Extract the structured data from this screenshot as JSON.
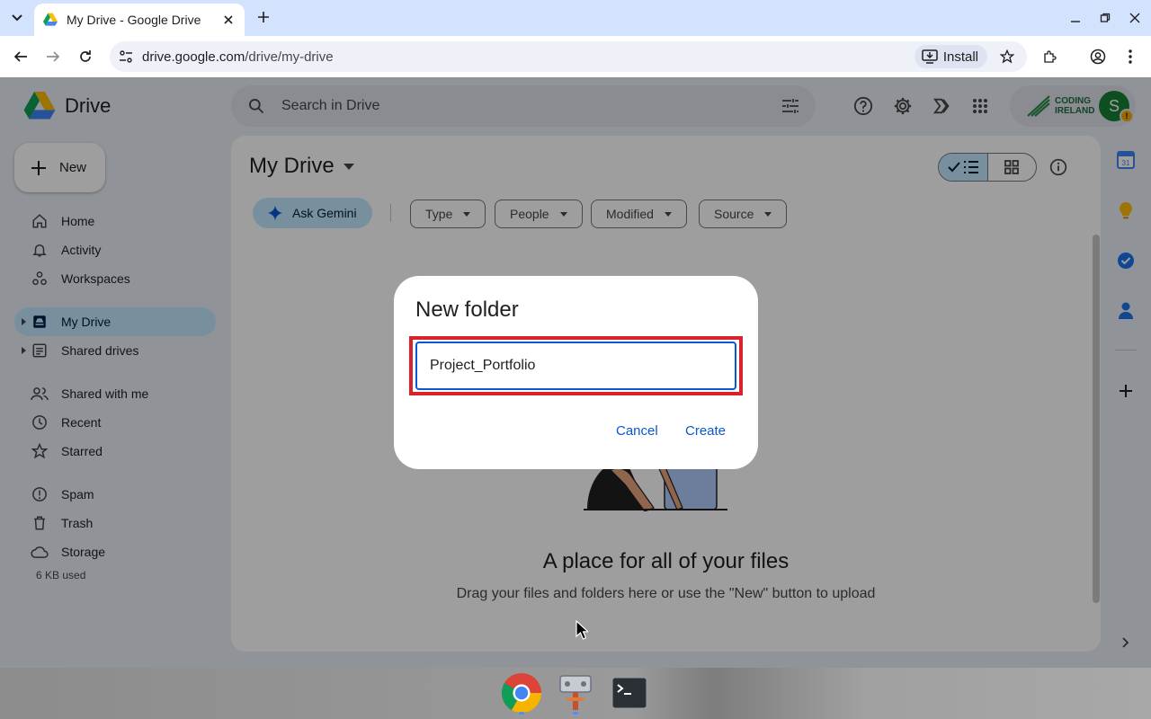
{
  "browser": {
    "tab_title": "My Drive - Google Drive",
    "url_host": "drive.google.com",
    "url_path": "/drive/my-drive",
    "install_label": "Install"
  },
  "header": {
    "app_name": "Drive",
    "search_placeholder": "Search in Drive",
    "org_logo_text_1": "CODING",
    "org_logo_text_2": "IRELAND",
    "avatar_initial": "S",
    "avatar_badge": "!"
  },
  "sidebar": {
    "new_label": "New",
    "items": [
      {
        "label": "Home",
        "icon": "home-icon"
      },
      {
        "label": "Activity",
        "icon": "bell-icon"
      },
      {
        "label": "Workspaces",
        "icon": "workspaces-icon"
      },
      {
        "label": "My Drive",
        "icon": "my-drive-icon",
        "active": true
      },
      {
        "label": "Shared drives",
        "icon": "shared-drives-icon"
      },
      {
        "label": "Shared with me",
        "icon": "people-icon"
      },
      {
        "label": "Recent",
        "icon": "clock-icon"
      },
      {
        "label": "Starred",
        "icon": "star-icon"
      },
      {
        "label": "Spam",
        "icon": "spam-icon"
      },
      {
        "label": "Trash",
        "icon": "trash-icon"
      },
      {
        "label": "Storage",
        "icon": "cloud-icon"
      }
    ],
    "storage_used": "6 KB used"
  },
  "main": {
    "title": "My Drive",
    "gemini_label": "Ask Gemini",
    "filters": [
      "Type",
      "People",
      "Modified",
      "Source"
    ],
    "empty_title": "A place for all of your files",
    "empty_subtitle": "Drag your files and folders here or use the \"New\" button to upload"
  },
  "side_panel": {
    "calendar_day": "31"
  },
  "dialog": {
    "title": "New folder",
    "input_value": "Project_Portfolio",
    "cancel_label": "Cancel",
    "create_label": "Create"
  },
  "colors": {
    "accent": "#0b57d0",
    "active_nav": "#c2e7ff",
    "highlight_border": "#d8232a"
  }
}
